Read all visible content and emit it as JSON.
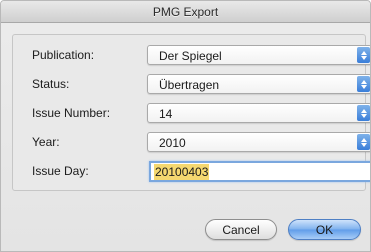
{
  "window": {
    "title": "PMG Export"
  },
  "form": {
    "publication": {
      "label": "Publication:",
      "value": "Der Spiegel"
    },
    "status": {
      "label": "Status:",
      "value": "Übertragen"
    },
    "issue_number": {
      "label": "Issue Number:",
      "value": "14"
    },
    "year": {
      "label": "Year:",
      "value": "2010"
    },
    "issue_day": {
      "label": "Issue Day:",
      "value": "20100403"
    }
  },
  "buttons": {
    "cancel": "Cancel",
    "ok": "OK"
  },
  "colors": {
    "accent": "#5f9ce9",
    "selection": "#f5d870",
    "focus_ring": "#7aa7de"
  }
}
